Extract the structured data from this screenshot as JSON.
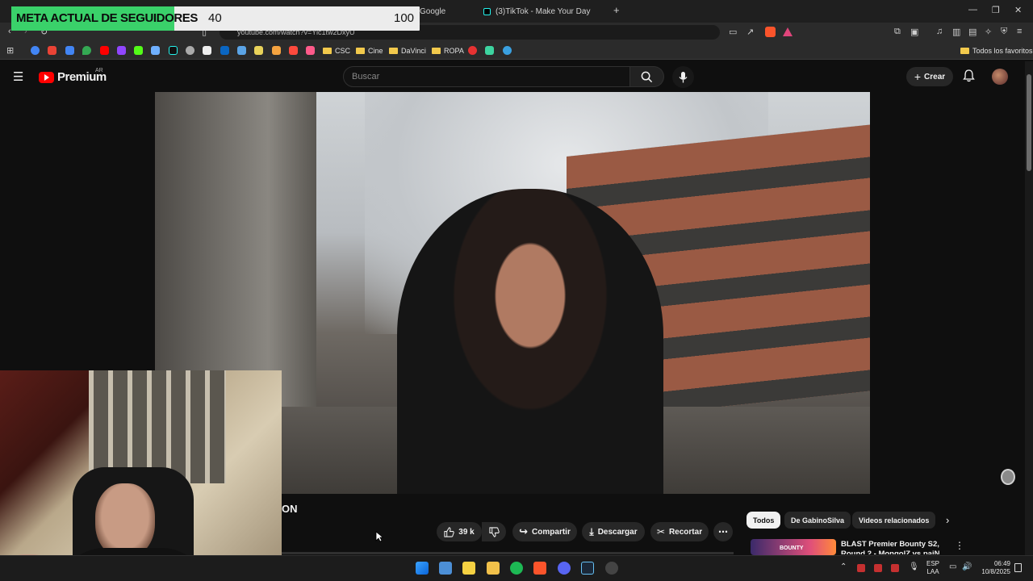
{
  "browser": {
    "tabs": [
      {
        "label": "Google"
      },
      {
        "label": "(3)TikTok - Make Your Day"
      }
    ],
    "new_tab_icon": "plus-icon",
    "url": "youtube.com/watch?v=Yic1tw2DxyU",
    "bookmarks_folders": [
      "CSC",
      "Cine",
      "DaVinci",
      "ROPA"
    ],
    "all_bookmarks_label": "Todos los favoritos"
  },
  "overlay": {
    "title": "META ACTUAL DE SEGUIDORES",
    "current": "40",
    "goal": "100",
    "progress_fraction": 0.4
  },
  "youtube": {
    "logo_text": "Premium",
    "region": "AR",
    "search_placeholder": "Buscar",
    "create_label": "Crear",
    "title_fragment": "ON",
    "likes": "39 k",
    "share_label": "Compartir",
    "download_label": "Descargar",
    "clip_label": "Recortar",
    "chips": [
      "Todos",
      "De GabinoSilva",
      "Videos relacionados"
    ],
    "recommended": {
      "thumb_text": "BOUNTY",
      "title": "BLAST Premier Bounty S2, Round 2 - MongolZ vs paiN"
    }
  },
  "taskbar": {
    "language": [
      "ESP",
      "LAA"
    ],
    "time": "06:49",
    "date": "10/8/2025"
  },
  "colors": {
    "youtube_red": "#ff0000",
    "meta_green": "#3ad16a",
    "bg": "#0f0f0f"
  }
}
